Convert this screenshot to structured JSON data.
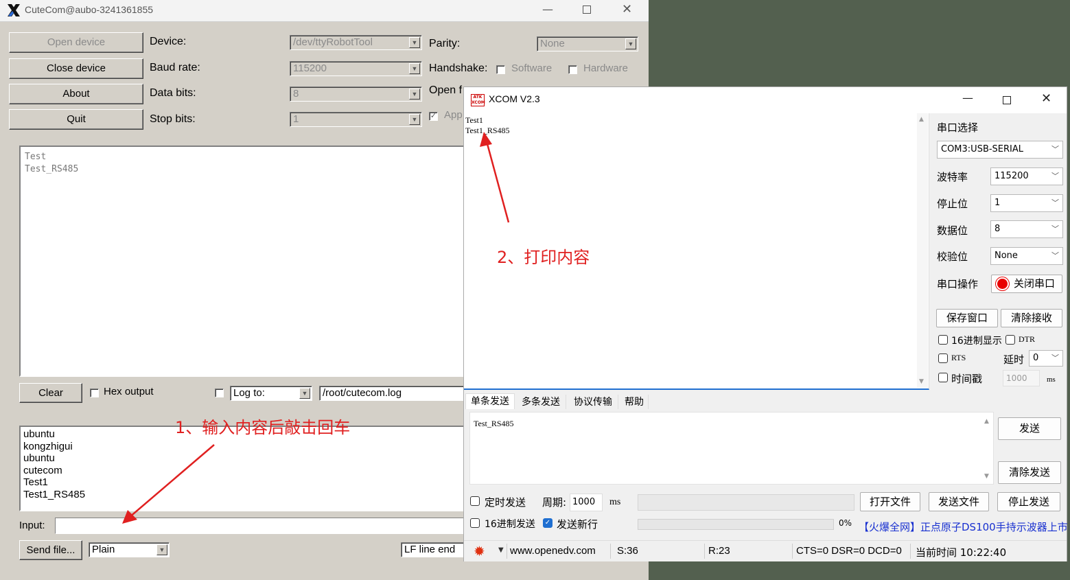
{
  "cutecom": {
    "title": "CuteCom@aubo-3241361855",
    "buttons": {
      "open_device": "Open device",
      "close_device": "Close device",
      "about": "About",
      "quit": "Quit",
      "clear": "Clear",
      "send_file": "Send file..."
    },
    "settings": {
      "device_label": "Device:",
      "device_value": "/dev/ttyRobotTool",
      "baud_label": "Baud rate:",
      "baud_value": "115200",
      "data_bits_label": "Data bits:",
      "data_bits_value": "8",
      "stop_bits_label": "Stop bits:",
      "stop_bits_value": "1",
      "parity_label": "Parity:",
      "parity_value": "None",
      "handshake_label": "Handshake:",
      "software": "Software",
      "hardware": "Hardware",
      "open_for_partial": "Open f",
      "apply_partial": "App"
    },
    "output_lines": [
      "Test",
      "Test_RS485"
    ],
    "hex_output": "Hex output",
    "log_to": "Log to:",
    "log_path": "/root/cutecom.log",
    "history": [
      "ubuntu",
      "kongzhigui",
      "ubuntu",
      "cutecom",
      "Test1",
      "Test1_RS485"
    ],
    "input_label": "Input:",
    "input_value": "",
    "send_mode": "Plain",
    "line_end": "LF line end"
  },
  "annotations": {
    "note1": "1、输入内容后敲击回车",
    "note2": "2、打印内容"
  },
  "xcom": {
    "title": "XCOM V2.3",
    "logo_text": "ATK XCOM",
    "receive_lines": [
      "Test1",
      "Test1_RS485"
    ],
    "port_select_label": "串口选择",
    "port_value": "COM3:USB-SERIAL",
    "baud_label": "波特率",
    "baud_value": "115200",
    "stop_label": "停止位",
    "stop_value": "1",
    "data_label": "数据位",
    "data_value": "8",
    "parity_label": "校验位",
    "parity_value": "None",
    "port_op_label": "串口操作",
    "close_port": "关闭串口",
    "save_window": "保存窗口",
    "clear_receive": "清除接收",
    "hex_display": "16进制显示",
    "dtr": "DTR",
    "rts": "RTS",
    "delay_label": "延时",
    "delay_value": "0",
    "timestamp": "时间戳",
    "timestamp_value": "1000",
    "ms": "ms",
    "tabs": [
      "单条发送",
      "多条发送",
      "协议传输",
      "帮助"
    ],
    "send_text": "Test_RS485",
    "send_btn": "发送",
    "clear_send": "清除发送",
    "timed_send": "定时发送",
    "period_label": "周期:",
    "period_value": "1000",
    "period_ms": "ms",
    "open_file": "打开文件",
    "send_file": "发送文件",
    "stop_send": "停止发送",
    "hex_send": "16进制发送",
    "send_newline": "发送新行",
    "progress_pct": "0%",
    "ad_text": "【火爆全网】正点原子DS100手持示波器上市",
    "status": {
      "website": "www.openedv.com",
      "sent": "S:36",
      "received": "R:23",
      "lines": "CTS=0 DSR=0 DCD=0",
      "time": "当前时间 10:22:40"
    }
  }
}
